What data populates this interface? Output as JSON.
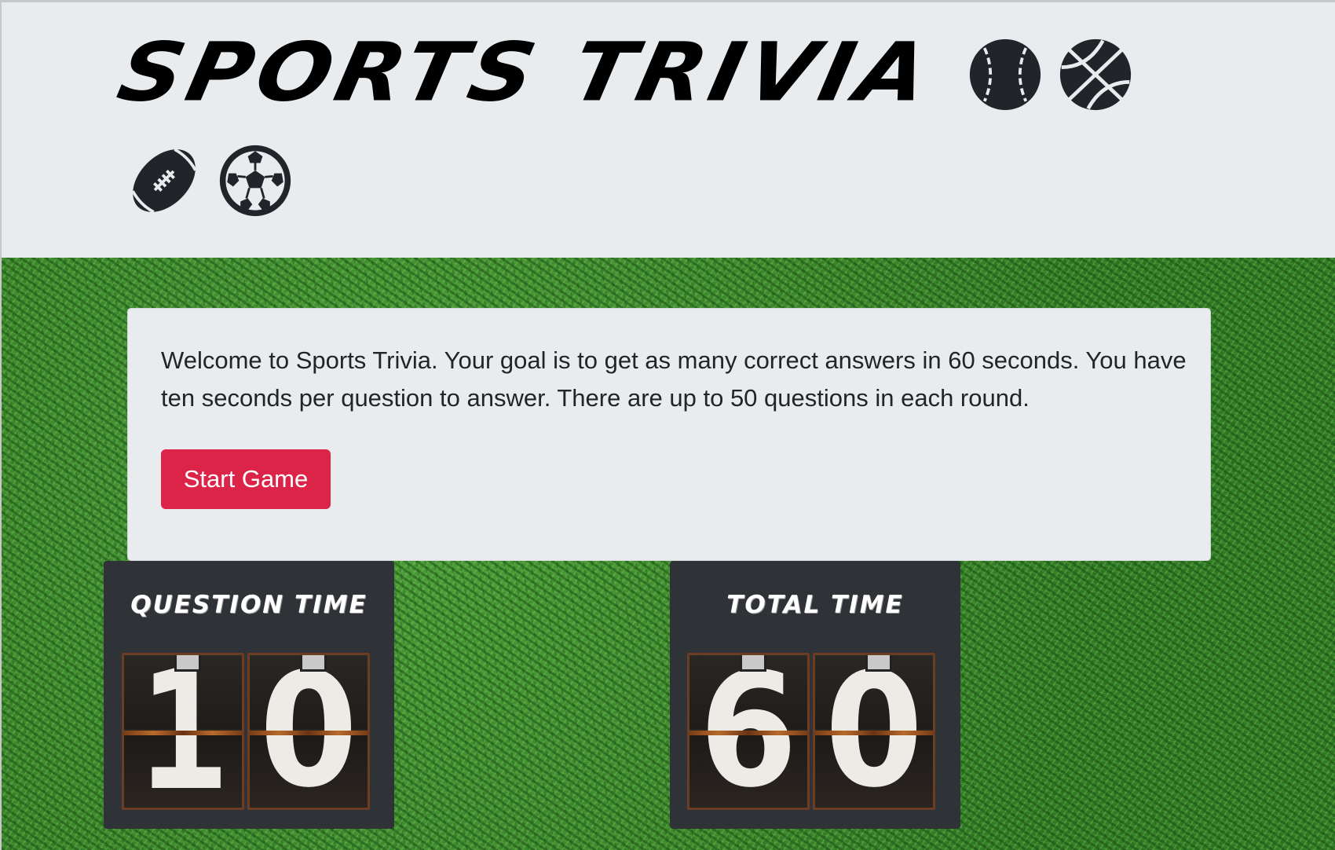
{
  "header": {
    "title": "SPORTS TRIVIA",
    "icons": [
      "baseball-icon",
      "basketball-icon",
      "football-icon",
      "soccer-ball-icon"
    ]
  },
  "intro": {
    "text": "Welcome to Sports Trivia. Your goal is to get as many correct answers in 60 seconds. You have ten seconds per question to answer. There are up to 50 questions in each round.",
    "start_button": "Start Game"
  },
  "timers": {
    "question": {
      "label": "QUESTION TIME",
      "digit_1": "1",
      "digit_2": "0"
    },
    "total": {
      "label": "TOTAL TIME",
      "digit_1": "6",
      "digit_2": "0"
    }
  },
  "colors": {
    "header_bg": "#e9ecef",
    "button": "#dc2348",
    "timer_panel": "#2f3237",
    "field_green": "#3d8a2e"
  }
}
